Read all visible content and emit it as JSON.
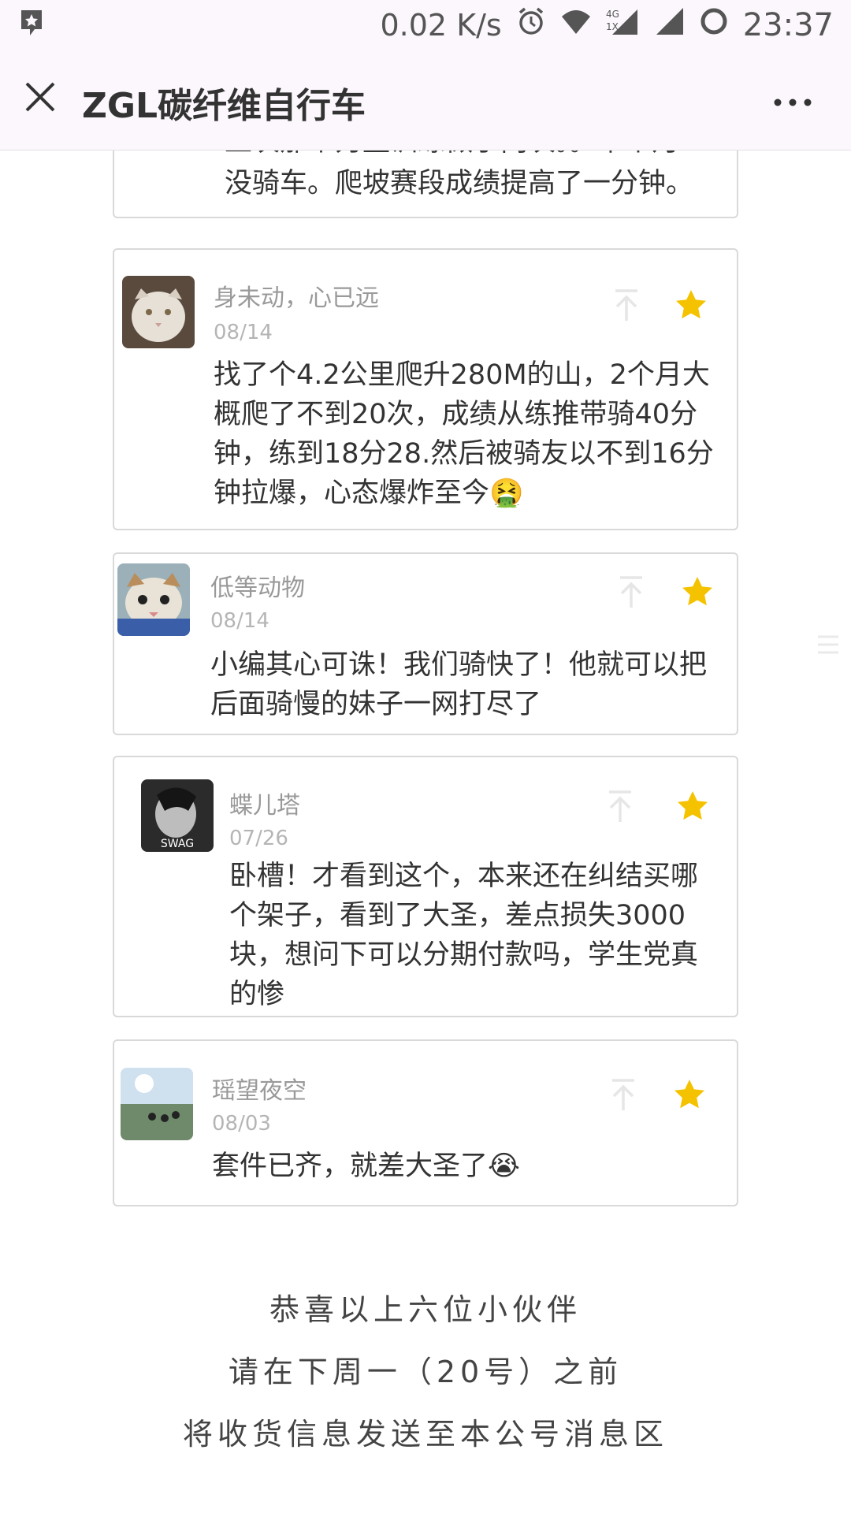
{
  "status_bar": {
    "net_speed": "0.02 K/s",
    "time": "23:37",
    "network_type": "4G 1X"
  },
  "header": {
    "title": "ZGL碳纤维自行车"
  },
  "partial_card": {
    "cut_line": "上次那个力量训练做了两次。。半个月",
    "last_line": "没骑车。爬坡赛段成绩提高了一分钟。"
  },
  "comments": [
    {
      "name": "身未动，心已远",
      "date": "08/14",
      "text": "找了个4.2公里爬升280M的山，2个月大概爬了不到20次，成绩从练推带骑40分钟，练到18分28.然后被骑友以不到16分钟拉爆，心态爆炸至今",
      "emoji": "🤮"
    },
    {
      "name": "低等动物",
      "date": "08/14",
      "text": "小编其心可诛！我们骑快了！他就可以把后面骑慢的妹子一网打尽了"
    },
    {
      "name": "蝶儿塔",
      "date": "07/26",
      "text": "卧槽！才看到这个，本来还在纠结买哪个架子，看到了大圣，差点损失3000块，想问下可以分期付款吗，学生党真的惨",
      "avatar_text": "SWAG"
    },
    {
      "name": "瑶望夜空",
      "date": "08/03",
      "text": "套件已齐，就差大圣了",
      "emoji": "😭"
    }
  ],
  "footer": {
    "line1": "恭喜以上六位小伙伴",
    "line2": "请在下周一（20号）之前",
    "line3": "将收货信息发送至本公号消息区"
  },
  "colors": {
    "star": "#f5c200",
    "header_bg": "#fbf7fc"
  }
}
